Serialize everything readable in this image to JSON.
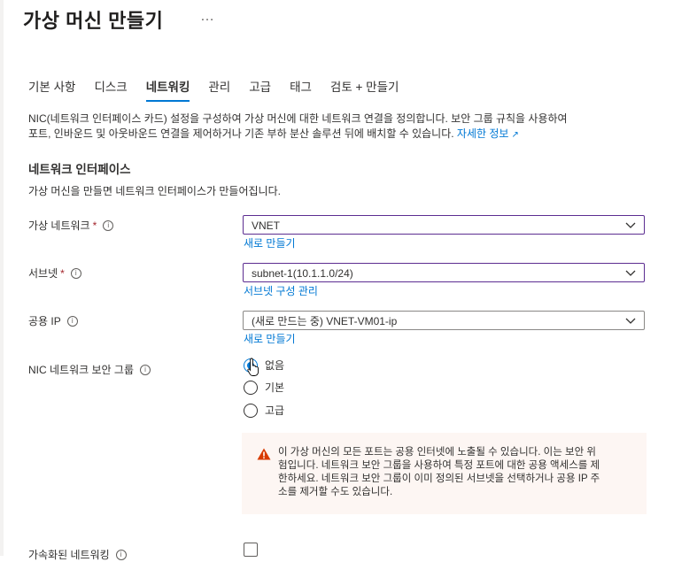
{
  "page": {
    "title": "가상 머신 만들기",
    "more": "…"
  },
  "tabs": [
    {
      "label": "기본 사항"
    },
    {
      "label": "디스크"
    },
    {
      "label": "네트워킹"
    },
    {
      "label": "관리"
    },
    {
      "label": "고급"
    },
    {
      "label": "태그"
    },
    {
      "label": "검토 + 만들기"
    }
  ],
  "intro": {
    "text_line1": "NIC(네트워크 인터페이스 카드) 설정을 구성하여 가상 머신에 대한 네트워크 연결을 정의합니다. 보안 그룹 규칙을 사용하여",
    "text_line2": "포트, 인바운드 및 아웃바운드 연결을 제어하거나 기존 부하 분산 솔루션 뒤에 배치할 수 있습니다.",
    "link": "자세한 정보"
  },
  "network_interface": {
    "title": "네트워크 인터페이스",
    "description": "가상 머신을 만들면 네트워크 인터페이스가 만들어집니다."
  },
  "fields": {
    "vnet": {
      "label": "가상 네트워크",
      "required": "*",
      "value": "VNET",
      "link": "새로 만들기"
    },
    "subnet": {
      "label": "서브넷",
      "required": "*",
      "value": "subnet-1(10.1.1.0/24)",
      "link": "서브넷 구성 관리"
    },
    "public_ip": {
      "label": "공용 IP",
      "value": "(새로 만드는 중) VNET-VM01-ip",
      "link": "새로 만들기"
    },
    "nsg": {
      "label": "NIC 네트워크 보안 그룹",
      "options": [
        {
          "label": "없음",
          "checked": true
        },
        {
          "label": "기본",
          "checked": false
        },
        {
          "label": "고급",
          "checked": false
        }
      ]
    },
    "accelerated": {
      "label": "가속화된 네트워킹"
    }
  },
  "warning": {
    "line1": "이 가상 머신의 모든 포트는 공용 인터넷에 노출될 수 있습니다. 이는 보안 위",
    "line2": "험입니다. 네트워크 보안 그룹을 사용하여 특정 포트에 대한 공용 액세스를 제",
    "line3": "한하세요. 네트워크 보안 그룹이 이미 정의된 서브넷을 선택하거나 공용 IP 주",
    "line4": "소를 제거할 수도 있습니다."
  },
  "colors": {
    "accent": "#0078d4",
    "active_border": "#5c2d91",
    "required": "#a4262c",
    "warning_bg": "#fdf6f3",
    "warning_icon": "#d83b01"
  }
}
